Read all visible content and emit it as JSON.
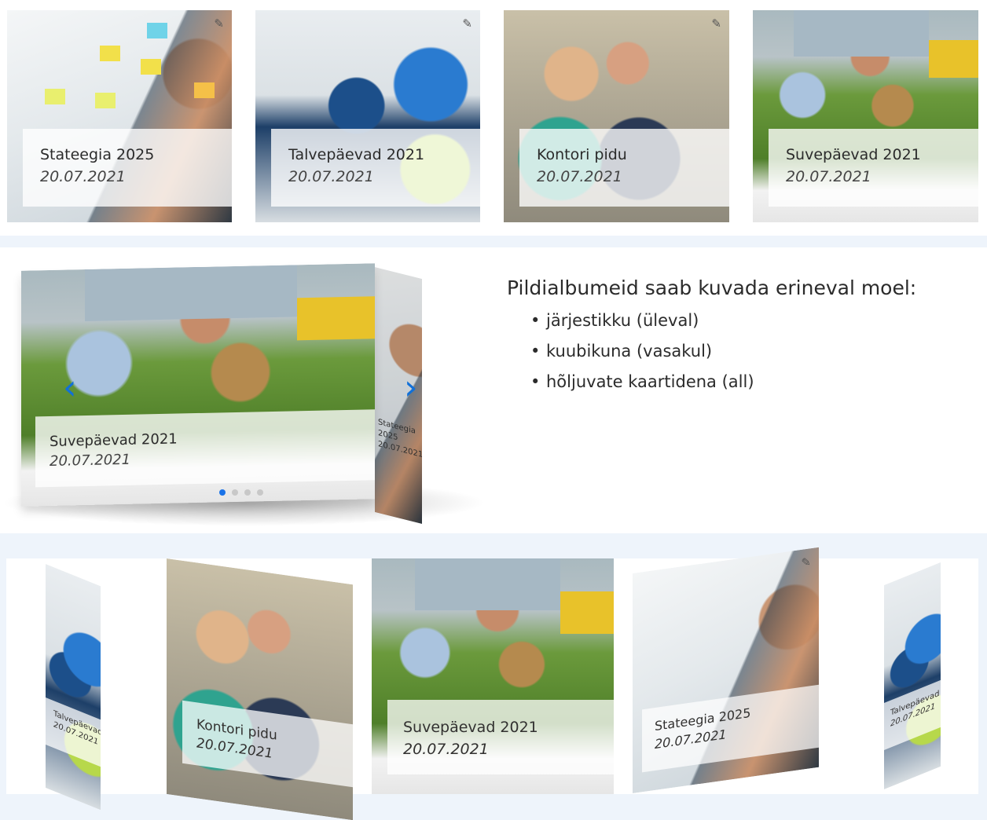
{
  "albums": [
    {
      "title": "Stateegia 2025",
      "date": "20.07.2021"
    },
    {
      "title": "Talvepäevad 2021",
      "date": "20.07.2021"
    },
    {
      "title": "Kontori pidu",
      "date": "20.07.2021"
    },
    {
      "title": "Suvepäevad 2021",
      "date": "20.07.2021"
    }
  ],
  "cube": {
    "title": "Suvepäevad 2021",
    "date": "20.07.2021",
    "side_title": "Stateegia 2025",
    "side_date": "20.07.2021",
    "prev_icon": "‹",
    "next_icon": "›",
    "dots": 4,
    "active_dot": 1
  },
  "info": {
    "title": "Pildialbumeid saab kuvada erineval moel:",
    "items": [
      "järjestikku (üleval)",
      "kuubikuna (vasakul)",
      "hõljuvate kaartidena (all)"
    ]
  },
  "floating": [
    {
      "title": "Talvepäevad 2021",
      "date": "20.07.2021"
    },
    {
      "title": "Kontori pidu",
      "date": "20.07.2021"
    },
    {
      "title": "Suvepäevad 2021",
      "date": "20.07.2021"
    },
    {
      "title": "Stateegia 2025",
      "date": "20.07.2021"
    },
    {
      "title": "Talvepäevad 2021",
      "date": "20.07.2021"
    }
  ],
  "icons": {
    "edit": "✎"
  }
}
